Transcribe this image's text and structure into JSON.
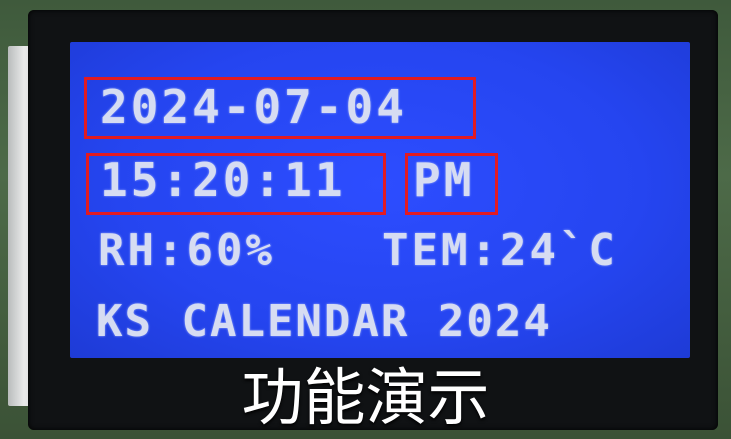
{
  "lcd": {
    "date": "2024-07-04",
    "time": "15:20:11",
    "ampm": "PM",
    "humidity": "RH:60%",
    "temperature": "TEM:24`C",
    "title": "KS CALENDAR 2024"
  },
  "caption": "功能演示",
  "colors": {
    "lcd_background": "#2545f0",
    "lcd_text": "#d6dcf2",
    "highlight_box": "#e21b22"
  }
}
